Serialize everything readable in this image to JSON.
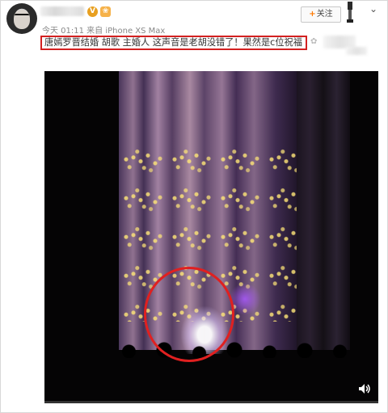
{
  "post": {
    "timestamp": "今天 01:11 来自 iPhone XS Max",
    "text": "唐嫣罗晋结婚 胡歌 主婚人 这声音是老胡没错了！果然是c位祝福",
    "follow_label": "关注",
    "follow_plus": "+",
    "verified_symbol": "V"
  },
  "video": {
    "progress": 0.0
  },
  "colors": {
    "highlight": "#e02020",
    "accent": "#ff7a00",
    "verified": "#e8a020"
  },
  "icons": {
    "verified": "verified-icon",
    "medal": "medal-icon",
    "bookmark": "bookmark-icon",
    "chevron": "chevron-down-icon",
    "volume": "volume-icon"
  }
}
